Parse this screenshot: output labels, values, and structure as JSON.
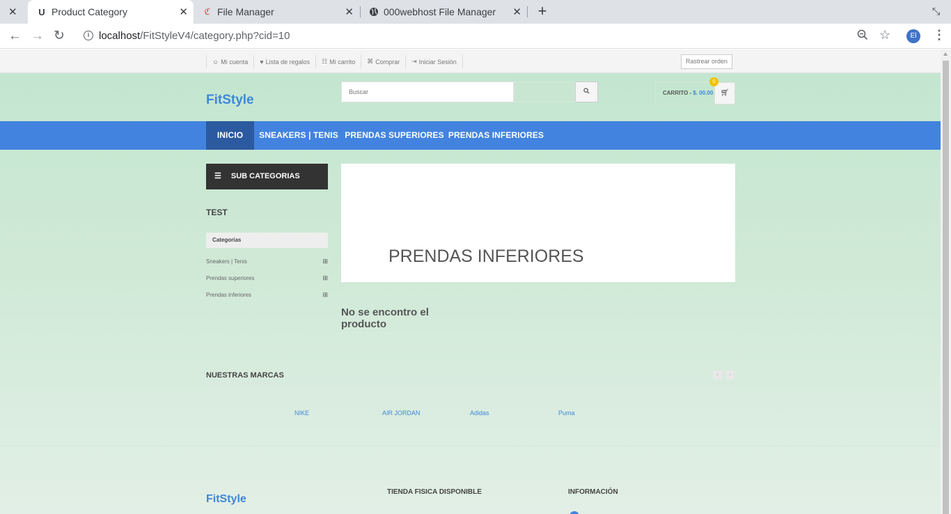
{
  "browser": {
    "tabs": [
      {
        "title": "Product Category",
        "favicon": "U"
      },
      {
        "title": "File Manager",
        "favicon": "file-manager-icon"
      },
      {
        "title": "000webhost File Manager",
        "favicon": "globe-icon"
      }
    ],
    "url_host": "localhost",
    "url_path": "/FitStyleV4/category.php?cid=10",
    "profile_initials": "El"
  },
  "topbar": {
    "links": [
      {
        "icon": "user-icon",
        "glyph": "☺",
        "label": "Mi cuenta"
      },
      {
        "icon": "heart-icon",
        "glyph": "♥",
        "label": "Lista de regalos"
      },
      {
        "icon": "cart-icon",
        "glyph": "☷",
        "label": "Mi carrito"
      },
      {
        "icon": "key-icon",
        "glyph": "⌘",
        "label": "Comprar"
      },
      {
        "icon": "login-icon",
        "glyph": "⇥",
        "label": "Iniciar Sesión"
      }
    ],
    "track_order": "Rastrear orden"
  },
  "header": {
    "logo": "FitStyle",
    "search_placeholder": "Buscar",
    "cart_label": "CARRITO - ",
    "cart_amount": "$. 00.00",
    "cart_count": "0"
  },
  "nav": {
    "items": [
      "INICIO",
      "SNEAKERS | TENIS",
      "PRENDAS SUPERIORES",
      "PRENDAS INFERIORES"
    ]
  },
  "sidebar": {
    "heading": "SUB CATEGORIAS",
    "section_title": "TEST",
    "categories_label": "Categorias",
    "categories": [
      "Sneakers | Tenis",
      "Prendas superiores",
      "Prendas inferiores"
    ]
  },
  "main": {
    "banner_title": "PRENDAS INFERIORES",
    "not_found_line1": "No se encontro el",
    "not_found_line2": "producto"
  },
  "brands": {
    "title": "NUESTRAS MARCAS",
    "items": [
      "NIKE",
      "AIR JORDAN",
      "Adidas",
      "Puma"
    ]
  },
  "footer": {
    "logo": "FitStyle",
    "store_heading": "TIENDA FISICA DISPONIBLE",
    "info_heading": "INFORMACIÓN"
  },
  "colors": {
    "accent": "#4283df",
    "nav_active": "#2c5aa0",
    "page_bg": "#c2e6cf",
    "badge": "#f2c200"
  }
}
